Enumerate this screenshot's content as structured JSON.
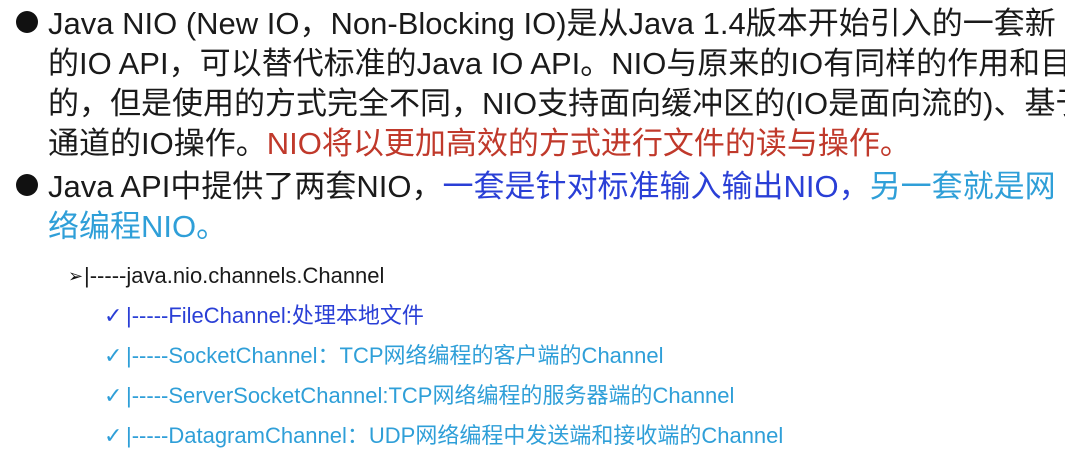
{
  "bullets": [
    {
      "lines": [
        "Java NIO (New IO，Non-Blocking IO)是从Java 1.4版本开始引入的一套新",
        "的IO API，可以替代标准的Java IO API。NIO与原来的IO有同样的作用和目",
        "的，但是使用的方式完全不同，NIO支持面向缓冲区的(IO是面向流的)、基于"
      ],
      "last_line_prefix": "通道的IO操作。",
      "last_line_highlight": "NIO将以更加高效的方式进行文件的读与操作。"
    },
    {
      "line1_prefix": "Java API中提供了两套NIO，",
      "line1_blue": "一套是针对标准输入输出NIO，",
      "line1_cyan": "另一套就是网",
      "line2_cyan": "络编程NIO。"
    }
  ],
  "tree": {
    "root_arrow": "➢",
    "root_label": "|-----java.nio.channels.Channel",
    "check": "✓",
    "items": [
      "|-----FileChannel:处理本地文件",
      "|-----SocketChannel：TCP网络编程的客户端的Channel",
      "|-----ServerSocketChannel:TCP网络编程的服务器端的Channel",
      "|-----DatagramChannel：UDP网络编程中发送端和接收端的Channel"
    ]
  },
  "colors": {
    "red": "#c0392b",
    "blue": "#2a3fd6",
    "cyan": "#2f9fd8",
    "text": "#1a1a1a"
  }
}
